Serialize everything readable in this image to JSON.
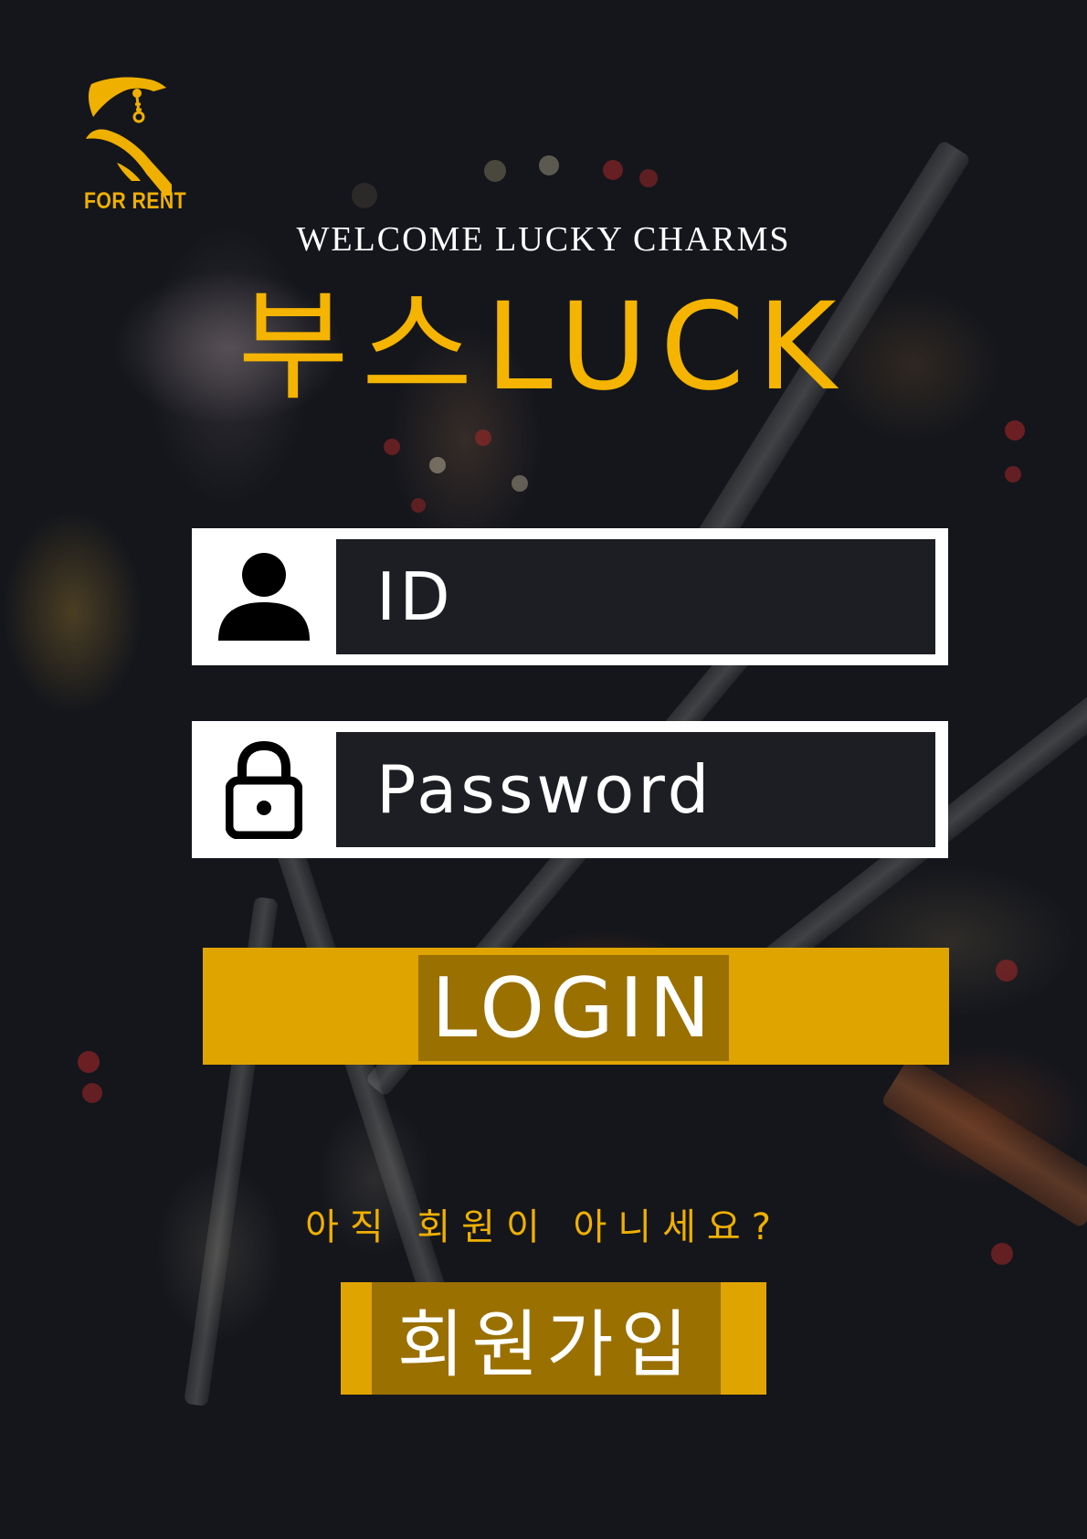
{
  "logo": {
    "text": "FOR RENT",
    "icon": "hand-with-keys-icon",
    "color": "#f0b000"
  },
  "header": {
    "welcome": "WELCOME LUCKY CHARMS",
    "brand": "부스LUCK"
  },
  "login_form": {
    "id_field": {
      "placeholder": "ID",
      "icon": "user-icon"
    },
    "password_field": {
      "placeholder": "Password",
      "icon": "lock-icon"
    },
    "login_label": "LOGIN"
  },
  "signup": {
    "prompt": "아직 회원이 아니세요?",
    "button_label": "회원가입"
  },
  "colors": {
    "accent": "#f5b400",
    "button": "#e0a400",
    "button_inner": "#9a7000",
    "background": "#14161c"
  }
}
